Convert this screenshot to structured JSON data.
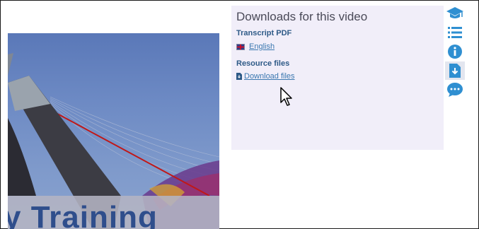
{
  "downloads": {
    "title": "Downloads for this video",
    "transcript_heading": "Transcript PDF",
    "transcript_link": "English",
    "resources_heading": "Resource files",
    "resources_link": "Download files"
  },
  "video": {
    "caption": "y Training"
  },
  "icon_rail": {
    "items": [
      "graduation-cap-icon",
      "list-icon",
      "info-icon",
      "download-icon",
      "chat-icon"
    ],
    "active": "download-icon"
  },
  "colors": {
    "panel_background": "#f1eef9",
    "heading": "#2e5a87",
    "link": "#3b78b0",
    "icon": "#2f8fd1"
  }
}
